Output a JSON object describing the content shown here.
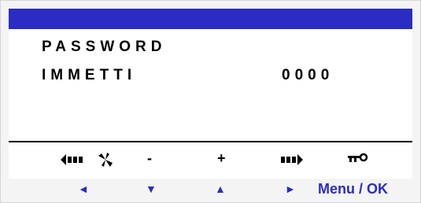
{
  "display": {
    "line1": "PASSWORD",
    "line2": "IMMETTI",
    "pin_value": "0000"
  },
  "softkeys": {
    "left_icon": "arrow-left-bars-icon",
    "fan_icon": "fan-icon",
    "minus": "-",
    "plus": "+",
    "right_icon": "arrow-right-bars-icon",
    "key_icon": "key-icon"
  },
  "nav": {
    "left": "◄",
    "down": "▼",
    "up": "▲",
    "right": "►",
    "menu_ok": "Menu / OK"
  },
  "colors": {
    "accent": "#2b2cc4",
    "screen_bg": "#ffffff",
    "frame_bg": "#f4f4f4"
  }
}
